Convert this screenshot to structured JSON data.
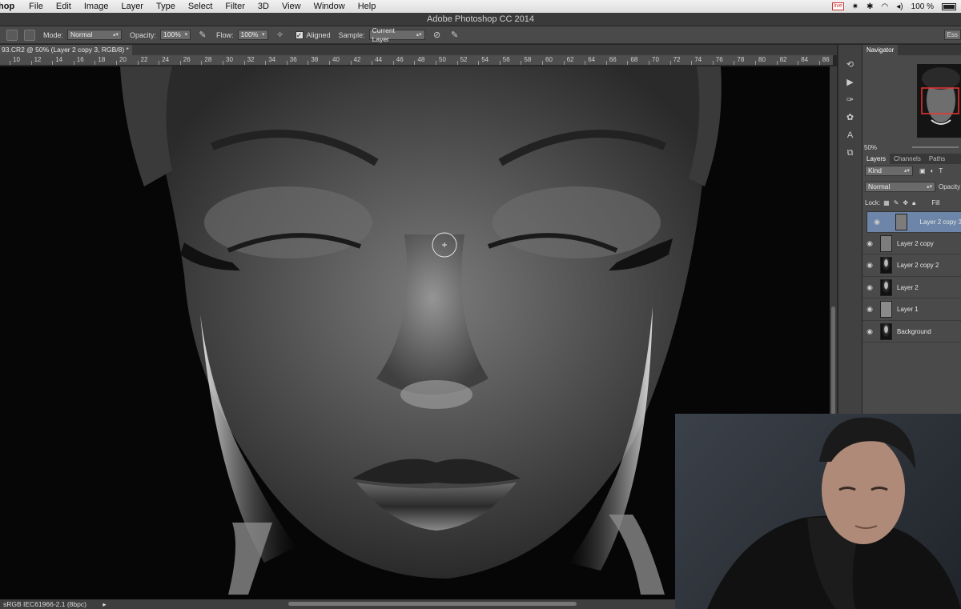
{
  "menubar": {
    "app": "hop",
    "items": [
      "File",
      "Edit",
      "Image",
      "Layer",
      "Type",
      "Select",
      "Filter",
      "3D",
      "View",
      "Window",
      "Help"
    ],
    "battery_text": "100 %",
    "rec_label": "live"
  },
  "titlebar": {
    "title": "Adobe Photoshop CC 2014"
  },
  "options": {
    "mode_label": "Mode:",
    "mode_value": "Normal",
    "opacity_label": "Opacity:",
    "opacity_value": "100%",
    "flow_label": "Flow:",
    "flow_value": "100%",
    "aligned_label": "Aligned",
    "sample_label": "Sample:",
    "sample_value": "Current Layer",
    "workspace": "Ess"
  },
  "document": {
    "tab_title": "93.CR2 @ 50% (Layer 2 copy 3, RGB/8) *"
  },
  "ruler": {
    "ticks": [
      "10",
      "12",
      "14",
      "16",
      "18",
      "20",
      "22",
      "24",
      "26",
      "28",
      "30",
      "32",
      "34",
      "36",
      "38",
      "40",
      "42",
      "44",
      "46",
      "48",
      "50",
      "52",
      "54",
      "56",
      "58",
      "60",
      "62",
      "64",
      "66",
      "68",
      "70",
      "72",
      "74",
      "76",
      "78",
      "80",
      "82",
      "84",
      "86"
    ]
  },
  "status": {
    "profile": "sRGB IEC61966-2.1 (8bpc)"
  },
  "navigator": {
    "tab": "Navigator",
    "zoom": "50%"
  },
  "layers_panel": {
    "tabs": [
      "Layers",
      "Channels",
      "Paths"
    ],
    "kind": "Kind",
    "blend_mode": "Normal",
    "opacity_label": "Opacity",
    "lock_label": "Lock:",
    "fill_label": "Fill",
    "layers": [
      {
        "name": "Layer 2 copy 3",
        "selected": true,
        "thumb": "gray"
      },
      {
        "name": "Layer 2 copy",
        "selected": false,
        "thumb": "gray"
      },
      {
        "name": "Layer 2 copy 2",
        "selected": false,
        "thumb": "portrait"
      },
      {
        "name": "Layer 2",
        "selected": false,
        "thumb": "portrait"
      },
      {
        "name": "Layer 1",
        "selected": false,
        "thumb": "light"
      },
      {
        "name": "Background",
        "selected": false,
        "thumb": "portrait"
      }
    ]
  },
  "colors": {
    "selection": "#6d85a8",
    "panel_bg": "#4a4a4a"
  }
}
